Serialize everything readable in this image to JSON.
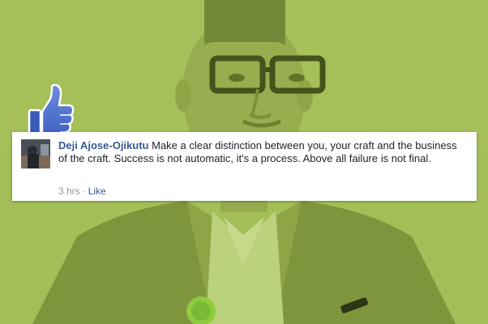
{
  "comment": {
    "author": "Deji Ajose-Ojikutu",
    "text": "Make a clear distinction between you, your craft and the business of the craft. Success is not automatic, it's a process. Above all failure is not final.",
    "time": "3 hrs",
    "separator": "·",
    "like_label": "Like"
  },
  "icons": {
    "thumb": "thumbs-up-icon",
    "avatar": "user-avatar"
  },
  "colors": {
    "overlay_green": "#a9c25e",
    "author_link": "#365899",
    "thumb_blue": "#4a6fd0"
  }
}
